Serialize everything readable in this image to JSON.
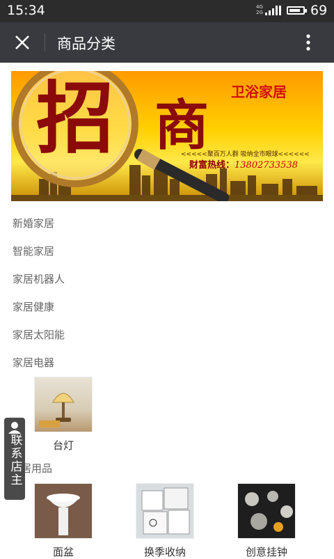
{
  "status_bar": {
    "time": "15:34",
    "network": "4G\n2G",
    "battery": "69"
  },
  "header": {
    "title": "商品分类"
  },
  "banner": {
    "big_char_1": "招",
    "big_char_2": "商",
    "brand": "卫浴家居",
    "slogan": "<<<<<聚百万人群  吸纳全市眼球<<<<<<",
    "hotline_label": "财富热线：",
    "hotline_number": "13802733538"
  },
  "categories": [
    "新婚家居",
    "智能家居",
    "家居机器人",
    "家居健康",
    "家居太阳能",
    "家居电器"
  ],
  "electrical_products": [
    {
      "label": "台灯"
    }
  ],
  "daily_section_title": "居用品",
  "daily_products": [
    {
      "label": "面盆"
    },
    {
      "label": "换季收纳"
    },
    {
      "label": "创意挂钟"
    }
  ],
  "contact_button": {
    "label": "联系店主"
  }
}
